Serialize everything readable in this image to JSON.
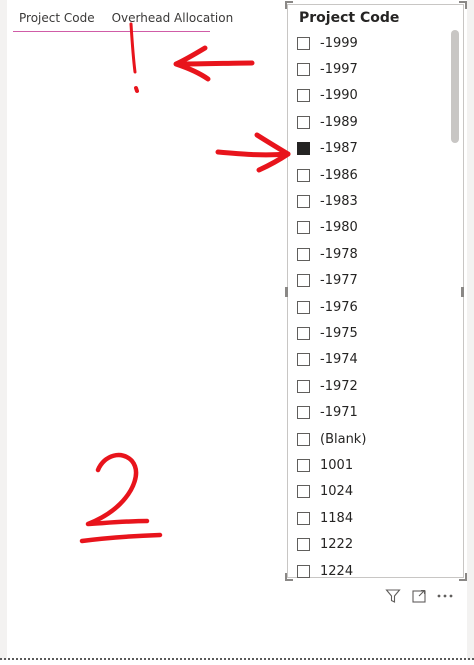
{
  "table": {
    "columns": [
      "Project Code",
      "Overhead Allocation"
    ]
  },
  "slicer": {
    "title": "Project Code",
    "items": [
      {
        "label": "-1999",
        "checked": false
      },
      {
        "label": "-1997",
        "checked": false
      },
      {
        "label": "-1990",
        "checked": false
      },
      {
        "label": "-1989",
        "checked": false
      },
      {
        "label": "-1987",
        "checked": true
      },
      {
        "label": "-1986",
        "checked": false
      },
      {
        "label": "-1983",
        "checked": false
      },
      {
        "label": "-1980",
        "checked": false
      },
      {
        "label": "-1978",
        "checked": false
      },
      {
        "label": "-1977",
        "checked": false
      },
      {
        "label": "-1976",
        "checked": false
      },
      {
        "label": "-1975",
        "checked": false
      },
      {
        "label": "-1974",
        "checked": false
      },
      {
        "label": "-1972",
        "checked": false
      },
      {
        "label": "-1971",
        "checked": false
      },
      {
        "label": "(Blank)",
        "checked": false
      },
      {
        "label": "1001",
        "checked": false
      },
      {
        "label": "1024",
        "checked": false
      },
      {
        "label": "1184",
        "checked": false
      },
      {
        "label": "1222",
        "checked": false
      },
      {
        "label": "1224",
        "checked": false
      }
    ]
  },
  "toolbar_icons": [
    "filter-icon",
    "focus-mode-icon",
    "more-options-icon"
  ],
  "annotations": {
    "exclamation": "!",
    "number": "2",
    "color": "#e8141c"
  }
}
